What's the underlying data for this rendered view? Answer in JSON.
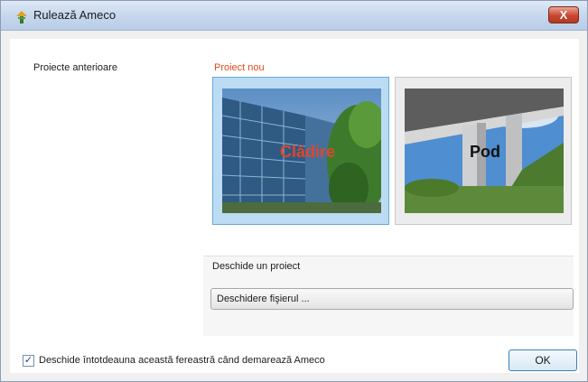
{
  "window": {
    "title": "Rulează Ameco",
    "close_glyph": "X"
  },
  "left_panel": {
    "heading": "Proiecte anterioare"
  },
  "new_project": {
    "heading": "Proiect nou",
    "heading_color": "#e04a1c",
    "tiles": [
      {
        "caption": "Clădire",
        "caption_color": "#e0462a",
        "selected": true,
        "icon": "building-photo"
      },
      {
        "caption": "Pod",
        "caption_color": "#111111",
        "selected": false,
        "icon": "bridge-photo"
      }
    ]
  },
  "open_project": {
    "heading": "Deschide un proiect",
    "button_label": "Deschidere fişierul ..."
  },
  "footer": {
    "checkbox_checked": true,
    "checkbox_label": "Deschide întotdeauna această fereastră când demarează Ameco",
    "ok_label": "OK"
  },
  "colors": {
    "accent_selected": "#6aa7d8",
    "title_bar": "#c9d9ee",
    "close_button": "#c9462e"
  }
}
